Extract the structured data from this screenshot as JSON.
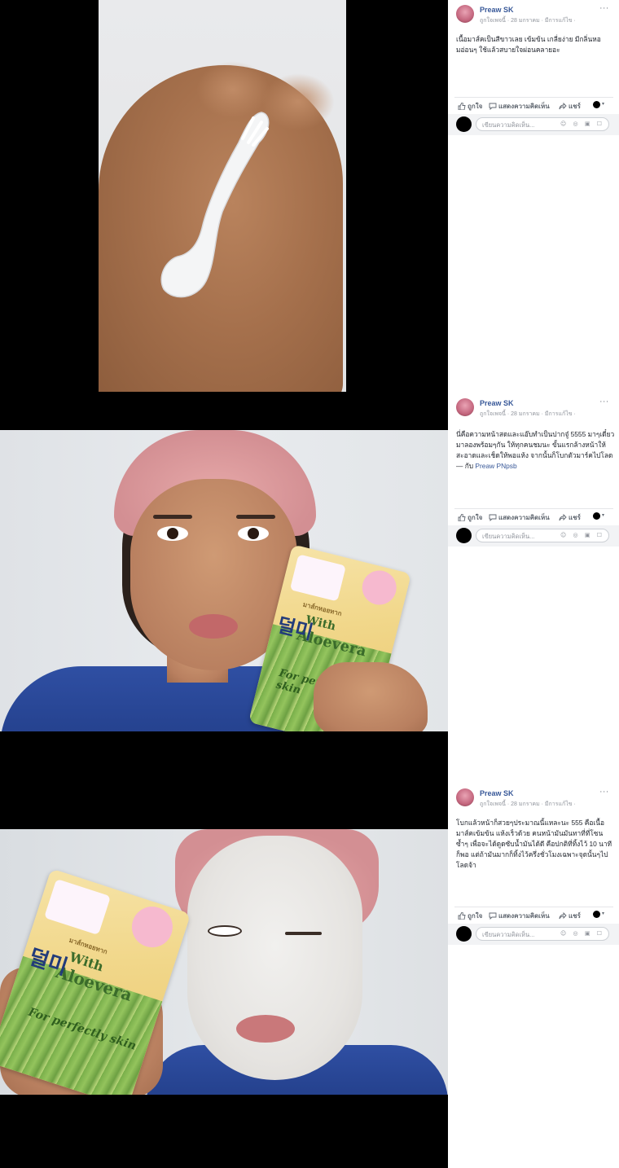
{
  "posts": [
    {
      "author": "Preaw SK",
      "meta": "ถูกใจเพจนี้ · 28 มกราคม · มีการแก้ไข ·",
      "text": "เนื้อมาส์คเป็นสีขาวเลย เข้มข้น เกลี่ยง่าย มีกลิ่นหอมอ่อนๆ ใช้แล้วสบายใจผ่อนคลายอะ",
      "tag": ""
    },
    {
      "author": "Preaw SK",
      "meta": "ถูกใจเพจนี้ · 28 มกราคม · มีการแก้ไข ·",
      "text": "นี่คือความหน้าสดและแอ๊บทำเป็นปากจู๋ 5555 มาๆเดี๋ยวมาลองพร้อมๆกัน ให้ทุกคนชมนะ ขั้นแรกล้างหน้าให้สะอาดและเช็ดให้พอแห้ง จากนั้นก็โบกตัวมาร์คไปโลด —",
      "tag_prefix": "กับ",
      "tag": "Preaw PNpsb"
    },
    {
      "author": "Preaw SK",
      "meta": "ถูกใจเพจนี้ · 28 มกราคม · มีการแก้ไข ·",
      "text": "โบกแล้วหน้าก็สวยๆประมาณนี้แหละนะ 555 คือเนื้อมาส์คเข้มข้น แห้งเร็วด้วย คนหน้ามันมันทาที่ที่โซนซ้ำๆ เพื่อจะได้ดูดซับน้ำมันได้ดี คือปกติที่ทิ้งไว้ 10 นาทีก็พอ แต่ถ้ามันมากก็ทิ้งไว้ครึ่งชั่วโมงเฉพาะจุดนั้นๆไปโลดจ้า",
      "tag": ""
    }
  ],
  "actions": {
    "like": "ถูกใจ",
    "comment": "แสดงความคิดเห็น",
    "share": "แชร์"
  },
  "comment_placeholder": "เขียนความคิดเห็น...",
  "more_icon": "···",
  "caret": "▾",
  "comment_icons": "☺ ◎ ▣ ☐",
  "pack_text": {
    "brand": "덜미",
    "with": "With",
    "aloe": "Aloevera",
    "slogan": "For perfectly skin",
    "thai": "มาส์กหอยทาก"
  }
}
